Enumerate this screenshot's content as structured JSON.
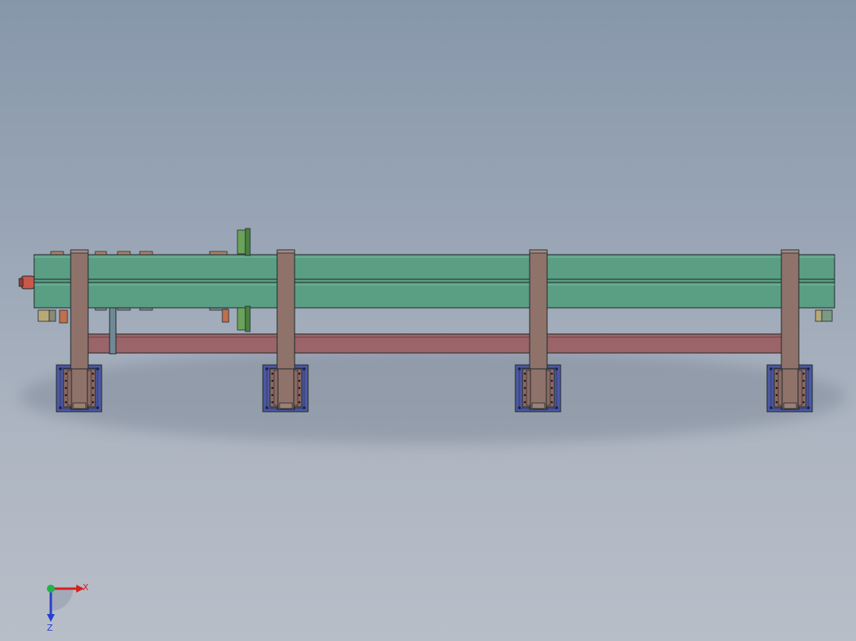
{
  "viewport": {
    "background_top": "#8797aa",
    "background_bottom": "#b8bec8"
  },
  "model": {
    "conveyor_color": "#5a9e84",
    "frame_color": "#8f726a",
    "lower_beam_color": "#9a6468",
    "base_plate_color": "#4d58a0",
    "edge_color": "#1e2a2a",
    "leg_count": 4
  },
  "triad": {
    "x_label": "X",
    "z_label": "Z",
    "x_color": "#d42020",
    "y_color": "#22b24a",
    "z_color": "#2a3ed0"
  }
}
